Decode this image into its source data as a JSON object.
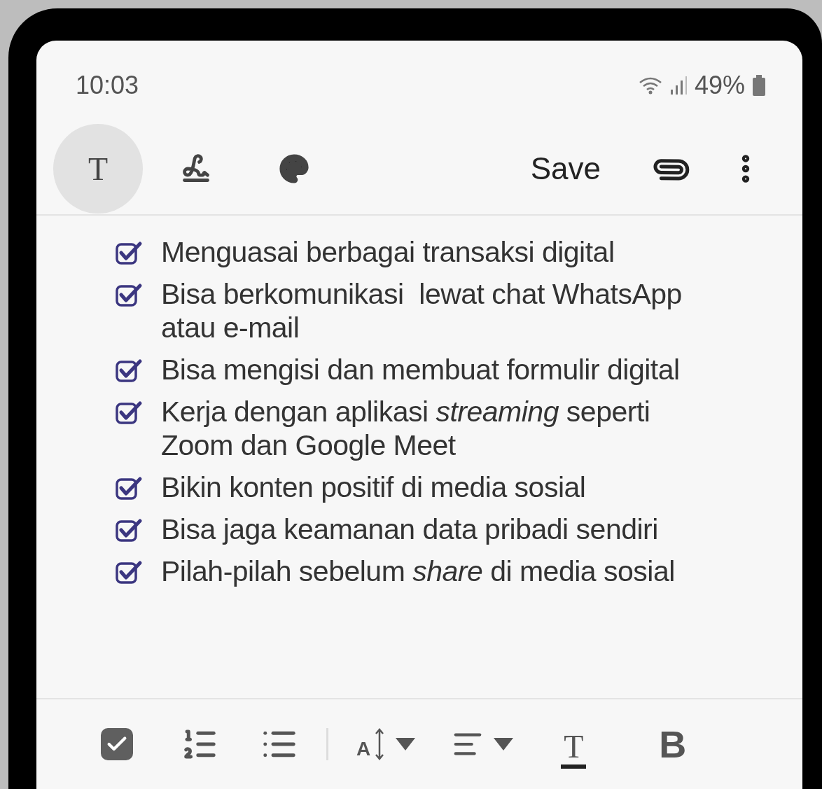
{
  "status_bar": {
    "time": "10:03",
    "battery": "49%"
  },
  "toolbar": {
    "modes": [
      {
        "kind": "text",
        "label": "T",
        "selected": true
      },
      {
        "kind": "pen",
        "selected": false
      },
      {
        "kind": "palette",
        "selected": false
      }
    ],
    "save": "Save"
  },
  "checklist": [
    {
      "text": "Menguasai berbagai transaksi digital",
      "checked": true
    },
    {
      "text": "Bisa berkomunikasi  lewat chat WhatsApp atau e-mail",
      "checked": true
    },
    {
      "text": "Bisa mengisi dan membuat formulir digital",
      "checked": true
    },
    {
      "text": "Kerja dengan aplikasi *streaming* seperti Zoom dan Google Meet",
      "checked": true
    },
    {
      "text": "Bikin konten positif di media sosial",
      "checked": true
    },
    {
      "text": "Bisa jaga keamanan data pribadi sendiri",
      "checked": true
    },
    {
      "text": "Pilah-pilah sebelum *share* di media sosial",
      "checked": true
    }
  ],
  "format_bar": {
    "font_size_label": "A",
    "text_color_label": "T",
    "bold_label": "B"
  }
}
